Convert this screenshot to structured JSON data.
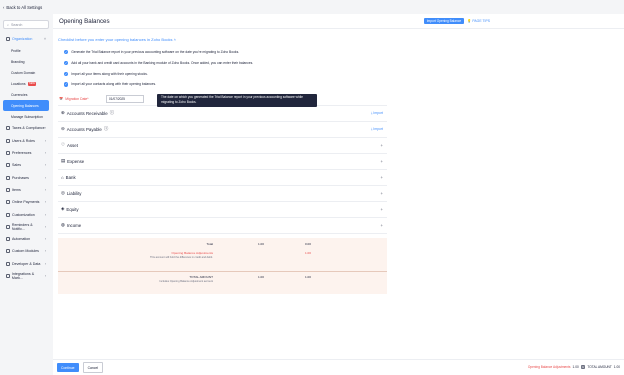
{
  "topbar": {
    "back_label": "Back to All Settings"
  },
  "sidebar": {
    "search_placeholder": "Search",
    "groups": [
      {
        "label": "Organization",
        "open": true
      },
      {
        "label": "Taxes & Compliance"
      },
      {
        "label": "Users & Roles"
      },
      {
        "label": "Preferences"
      },
      {
        "label": "Sales"
      },
      {
        "label": "Purchases"
      },
      {
        "label": "Items"
      },
      {
        "label": "Online Payments"
      },
      {
        "label": "Customization"
      },
      {
        "label": "Reminders & Notific..."
      },
      {
        "label": "Automation"
      },
      {
        "label": "Custom Modules"
      },
      {
        "label": "Developer & Data"
      },
      {
        "label": "Integrations & Mark..."
      }
    ],
    "org_items": [
      "Profile",
      "Branding",
      "Custom Domain",
      "Locations",
      "Currencies",
      "Opening Balances",
      "Manage Subscription"
    ],
    "new_badge": "NEW"
  },
  "header": {
    "title": "Opening Balances",
    "import_button": "Import Opening Balance",
    "page_tips": "PAGE TIPS"
  },
  "intro": {
    "link": "Checklist before you enter your opening balances in Zoho Books",
    "checklist": [
      "Generate the Trial Balance report in your previous accounting software on the date you're migrating to Zoho Books.",
      "Add all your bank and credit card accounts in the Banking module of Zoho Books. Once added, you can enter their balances.",
      "Import all your items along with their opening stocks.",
      "Import all your contacts along with their opening balances."
    ]
  },
  "migration": {
    "label": "Migration Date*",
    "date": "01/07/2025",
    "tooltip": "The date on which you generated the Trial Balance report in your previous accounting software while migrating to Zoho Books."
  },
  "sections": {
    "accounts_receivable": "Accounts Receivable",
    "accounts_payable": "Accounts Payable",
    "import_label": "Import",
    "asset": "Asset",
    "expense": "Expense",
    "bank": "Bank",
    "liability": "Liability",
    "equity": "Equity",
    "income": "Income"
  },
  "totals": {
    "total_label": "Total",
    "total_debit": "1.00",
    "total_credit": "0.00",
    "adjustment_label": "Opening Balance Adjustments",
    "adjustment_note": "This account will hold the difference in credit and debit.",
    "adjustment_credit": "1.00",
    "total_amount_label": "TOTAL AMOUNT",
    "total_amount_note": "Includes Opening Balance Adjustment account",
    "total_amount_debit": "1.00",
    "total_amount_credit": "1.00"
  },
  "footer": {
    "continue": "Continue",
    "cancel": "Cancel",
    "adjustment_label": "Opening Balance Adjustments",
    "adjustment_value": "1.00",
    "adjustment_dr_cr": "Cr",
    "total_label": "TOTAL AMOUNT",
    "total_value": "1.00"
  },
  "colors": {
    "accent": "#408dfb",
    "danger": "#e94b4b",
    "totals_bg": "#fdf3ee"
  }
}
